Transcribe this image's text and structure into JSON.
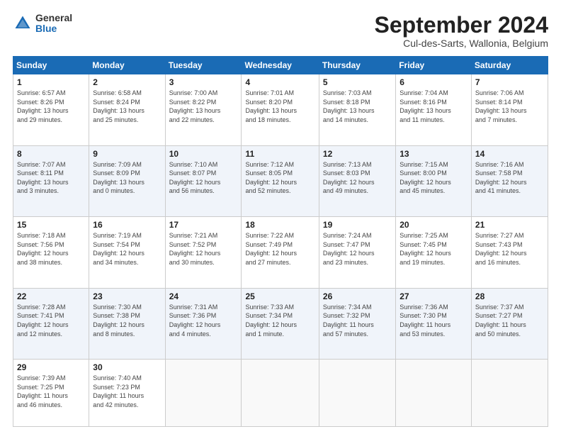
{
  "header": {
    "logo_general": "General",
    "logo_blue": "Blue",
    "month_title": "September 2024",
    "subtitle": "Cul-des-Sarts, Wallonia, Belgium"
  },
  "weekdays": [
    "Sunday",
    "Monday",
    "Tuesday",
    "Wednesday",
    "Thursday",
    "Friday",
    "Saturday"
  ],
  "weeks": [
    [
      {
        "day": "1",
        "info": "Sunrise: 6:57 AM\nSunset: 8:26 PM\nDaylight: 13 hours\nand 29 minutes."
      },
      {
        "day": "2",
        "info": "Sunrise: 6:58 AM\nSunset: 8:24 PM\nDaylight: 13 hours\nand 25 minutes."
      },
      {
        "day": "3",
        "info": "Sunrise: 7:00 AM\nSunset: 8:22 PM\nDaylight: 13 hours\nand 22 minutes."
      },
      {
        "day": "4",
        "info": "Sunrise: 7:01 AM\nSunset: 8:20 PM\nDaylight: 13 hours\nand 18 minutes."
      },
      {
        "day": "5",
        "info": "Sunrise: 7:03 AM\nSunset: 8:18 PM\nDaylight: 13 hours\nand 14 minutes."
      },
      {
        "day": "6",
        "info": "Sunrise: 7:04 AM\nSunset: 8:16 PM\nDaylight: 13 hours\nand 11 minutes."
      },
      {
        "day": "7",
        "info": "Sunrise: 7:06 AM\nSunset: 8:14 PM\nDaylight: 13 hours\nand 7 minutes."
      }
    ],
    [
      {
        "day": "8",
        "info": "Sunrise: 7:07 AM\nSunset: 8:11 PM\nDaylight: 13 hours\nand 3 minutes."
      },
      {
        "day": "9",
        "info": "Sunrise: 7:09 AM\nSunset: 8:09 PM\nDaylight: 13 hours\nand 0 minutes."
      },
      {
        "day": "10",
        "info": "Sunrise: 7:10 AM\nSunset: 8:07 PM\nDaylight: 12 hours\nand 56 minutes."
      },
      {
        "day": "11",
        "info": "Sunrise: 7:12 AM\nSunset: 8:05 PM\nDaylight: 12 hours\nand 52 minutes."
      },
      {
        "day": "12",
        "info": "Sunrise: 7:13 AM\nSunset: 8:03 PM\nDaylight: 12 hours\nand 49 minutes."
      },
      {
        "day": "13",
        "info": "Sunrise: 7:15 AM\nSunset: 8:00 PM\nDaylight: 12 hours\nand 45 minutes."
      },
      {
        "day": "14",
        "info": "Sunrise: 7:16 AM\nSunset: 7:58 PM\nDaylight: 12 hours\nand 41 minutes."
      }
    ],
    [
      {
        "day": "15",
        "info": "Sunrise: 7:18 AM\nSunset: 7:56 PM\nDaylight: 12 hours\nand 38 minutes."
      },
      {
        "day": "16",
        "info": "Sunrise: 7:19 AM\nSunset: 7:54 PM\nDaylight: 12 hours\nand 34 minutes."
      },
      {
        "day": "17",
        "info": "Sunrise: 7:21 AM\nSunset: 7:52 PM\nDaylight: 12 hours\nand 30 minutes."
      },
      {
        "day": "18",
        "info": "Sunrise: 7:22 AM\nSunset: 7:49 PM\nDaylight: 12 hours\nand 27 minutes."
      },
      {
        "day": "19",
        "info": "Sunrise: 7:24 AM\nSunset: 7:47 PM\nDaylight: 12 hours\nand 23 minutes."
      },
      {
        "day": "20",
        "info": "Sunrise: 7:25 AM\nSunset: 7:45 PM\nDaylight: 12 hours\nand 19 minutes."
      },
      {
        "day": "21",
        "info": "Sunrise: 7:27 AM\nSunset: 7:43 PM\nDaylight: 12 hours\nand 16 minutes."
      }
    ],
    [
      {
        "day": "22",
        "info": "Sunrise: 7:28 AM\nSunset: 7:41 PM\nDaylight: 12 hours\nand 12 minutes."
      },
      {
        "day": "23",
        "info": "Sunrise: 7:30 AM\nSunset: 7:38 PM\nDaylight: 12 hours\nand 8 minutes."
      },
      {
        "day": "24",
        "info": "Sunrise: 7:31 AM\nSunset: 7:36 PM\nDaylight: 12 hours\nand 4 minutes."
      },
      {
        "day": "25",
        "info": "Sunrise: 7:33 AM\nSunset: 7:34 PM\nDaylight: 12 hours\nand 1 minute."
      },
      {
        "day": "26",
        "info": "Sunrise: 7:34 AM\nSunset: 7:32 PM\nDaylight: 11 hours\nand 57 minutes."
      },
      {
        "day": "27",
        "info": "Sunrise: 7:36 AM\nSunset: 7:30 PM\nDaylight: 11 hours\nand 53 minutes."
      },
      {
        "day": "28",
        "info": "Sunrise: 7:37 AM\nSunset: 7:27 PM\nDaylight: 11 hours\nand 50 minutes."
      }
    ],
    [
      {
        "day": "29",
        "info": "Sunrise: 7:39 AM\nSunset: 7:25 PM\nDaylight: 11 hours\nand 46 minutes."
      },
      {
        "day": "30",
        "info": "Sunrise: 7:40 AM\nSunset: 7:23 PM\nDaylight: 11 hours\nand 42 minutes."
      },
      null,
      null,
      null,
      null,
      null
    ]
  ]
}
